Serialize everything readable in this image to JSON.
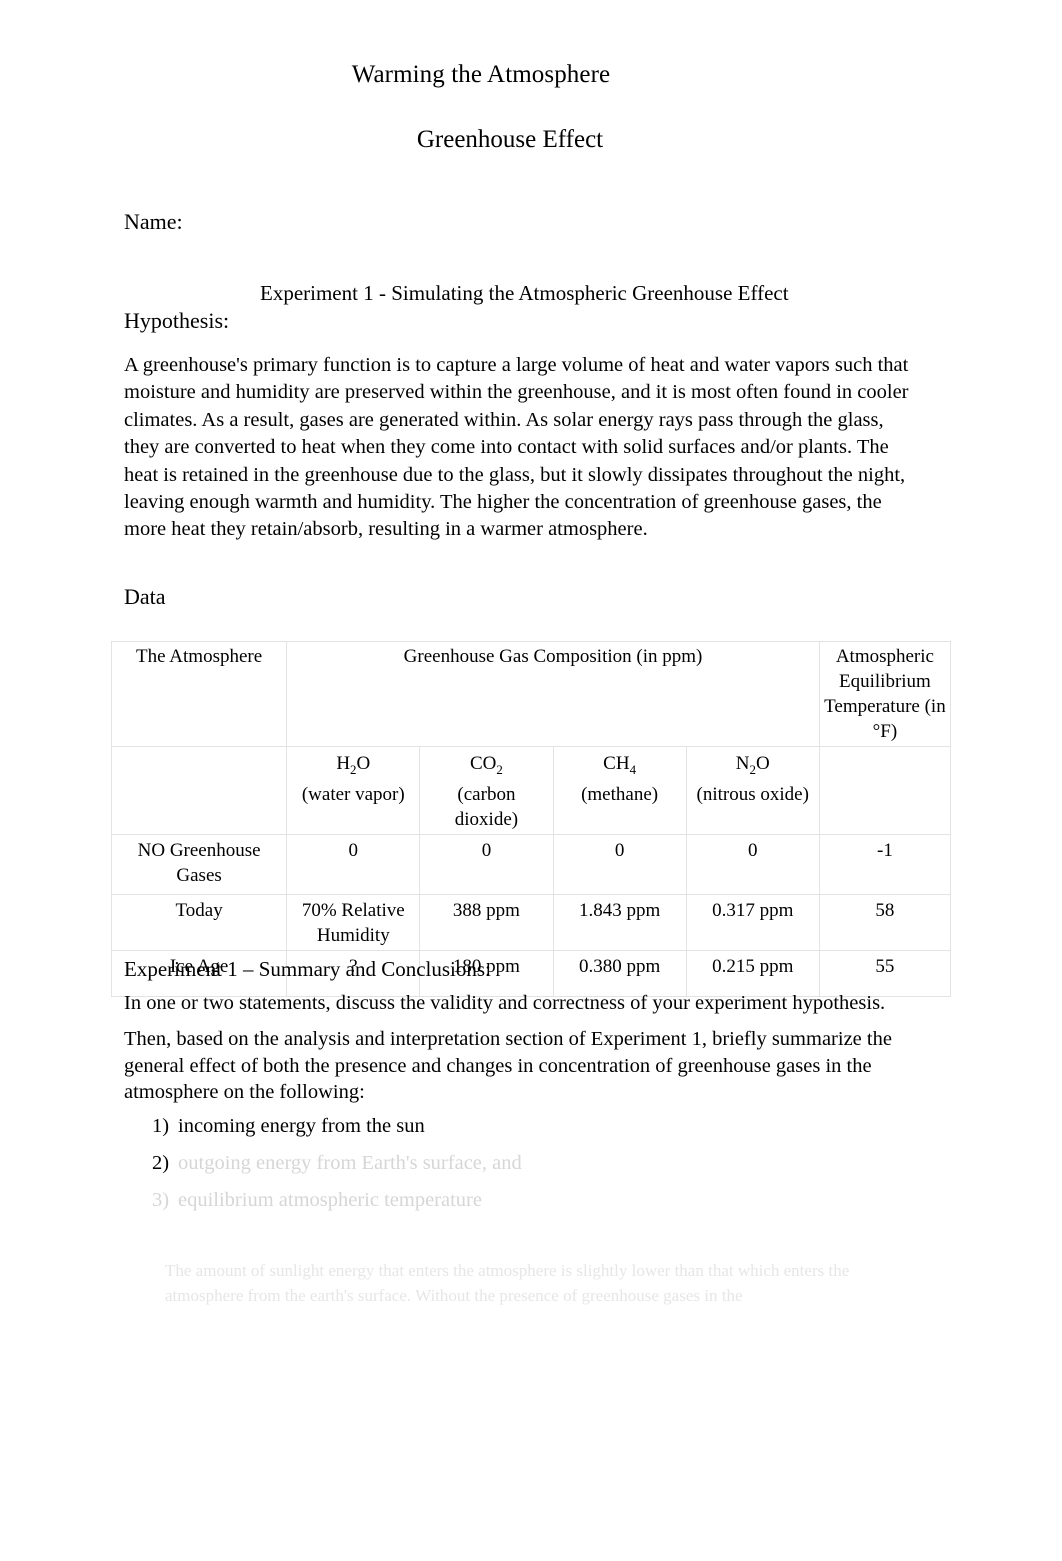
{
  "document": {
    "title": "Warming the Atmosphere",
    "subtitle": "Greenhouse Effect",
    "name_label": "Name:"
  },
  "experiment": {
    "heading": "Experiment 1 -  Simulating the Atmospheric Greenhouse Effect",
    "hypothesis_label": "Hypothesis:",
    "hypothesis_body": "A greenhouse's primary function is to capture a large volume of heat and water vapors such that moisture and humidity are preserved within the greenhouse, and it is most often found in cooler climates. As a result, gases are generated within. As solar energy rays pass through the glass, they are converted to heat when they come into contact with solid surfaces and/or plants. The heat is retained in the greenhouse due to the glass, but it slowly dissipates throughout the night, leaving enough warmth and humidity. The higher the concentration of greenhouse gases, the more heat they retain/absorb, resulting in a warmer atmosphere."
  },
  "data_section": {
    "label": "Data"
  },
  "table": {
    "header_atmosphere": "The Atmosphere",
    "header_composition": "Greenhouse Gas Composition (in ppm)",
    "header_temperature": "Atmospheric Equilibrium Temperature (in °F)",
    "gas_columns": [
      {
        "formula_main": "H",
        "formula_sub": "2",
        "formula_tail": "O",
        "name": "(water vapor)"
      },
      {
        "formula_main": "CO",
        "formula_sub": "2",
        "formula_tail": "",
        "name": "(carbon dioxide)"
      },
      {
        "formula_main": "CH",
        "formula_sub": "4",
        "formula_tail": "",
        "name": "(methane)"
      },
      {
        "formula_main": "N",
        "formula_sub": "2",
        "formula_tail": "O",
        "name": "(nitrous oxide)"
      }
    ],
    "rows": [
      {
        "label": "NO Greenhouse Gases",
        "h2o": "0",
        "co2": "0",
        "ch4": "0",
        "n2o": "0",
        "temperature": "-1"
      },
      {
        "label": "Today",
        "h2o": "70% Relative Humidity",
        "co2": "388 ppm",
        "ch4": "1.843 ppm",
        "n2o": "0.317 ppm",
        "temperature": "58"
      },
      {
        "label": "Ice Age",
        "h2o": "?",
        "co2": "180 ppm",
        "ch4": "0.380 ppm",
        "n2o": "0.215 ppm",
        "temperature": "55"
      }
    ]
  },
  "conclusions": {
    "heading": "Experiment 1 – Summary and Conclusions:",
    "line1": "In one or two statements, discuss the validity and correctness of your experiment hypothesis.",
    "paragraph": "Then, based on the analysis and interpretation section of Experiment 1, briefly summarize the general effect of both the presence and changes in concentration of greenhouse gases in the atmosphere on the following:",
    "items": [
      {
        "marker": "1)",
        "text": "incoming energy from the sun"
      },
      {
        "marker": "2)",
        "text": "outgoing energy from Earth's surface, and"
      },
      {
        "marker": "3)",
        "text": "equilibrium atmospheric temperature"
      }
    ],
    "faded_answer": "The amount of sunlight energy that enters the atmosphere is slightly lower than that which enters the atmosphere from the earth's surface. Without the presence of greenhouse gases in the"
  }
}
